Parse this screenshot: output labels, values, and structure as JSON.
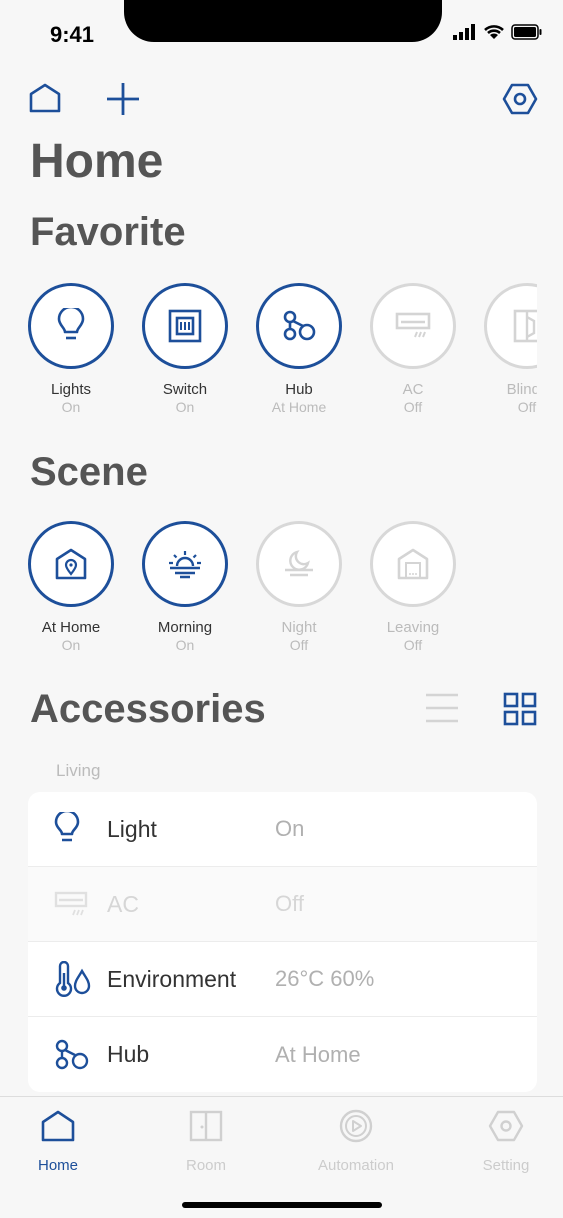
{
  "status": {
    "time": "9:41"
  },
  "header": {
    "title": "Home"
  },
  "favorite": {
    "title": "Favorite",
    "items": [
      {
        "label": "Lights",
        "state": "On",
        "icon": "bulb-icon",
        "active": true
      },
      {
        "label": "Switch",
        "state": "On",
        "icon": "switch-icon",
        "active": true
      },
      {
        "label": "Hub",
        "state": "At Home",
        "icon": "hub-icon",
        "active": true
      },
      {
        "label": "AC",
        "state": "Off",
        "icon": "ac-icon",
        "active": false
      },
      {
        "label": "Blinds",
        "state": "Off",
        "icon": "blinds-icon",
        "active": false
      }
    ]
  },
  "scene": {
    "title": "Scene",
    "items": [
      {
        "label": "At Home",
        "state": "On",
        "icon": "home-location-icon",
        "active": true
      },
      {
        "label": "Morning",
        "state": "On",
        "icon": "sunrise-icon",
        "active": true
      },
      {
        "label": "Night",
        "state": "Off",
        "icon": "moon-icon",
        "active": false
      },
      {
        "label": "Leaving",
        "state": "Off",
        "icon": "leave-home-icon",
        "active": false
      }
    ]
  },
  "accessories": {
    "title": "Accessories",
    "room": "Living",
    "rows": [
      {
        "name": "Light",
        "value": "On",
        "icon": "bulb-icon",
        "active": true
      },
      {
        "name": "AC",
        "value": "Off",
        "icon": "ac-icon",
        "active": false
      },
      {
        "name": "Environment",
        "value": "26°C 60%",
        "icon": "thermo-humidity-icon",
        "active": true
      },
      {
        "name": "Hub",
        "value": "At Home",
        "icon": "hub-icon",
        "active": true
      }
    ]
  },
  "tabs": [
    {
      "label": "Home",
      "icon": "home-icon",
      "active": true
    },
    {
      "label": "Room",
      "icon": "door-icon",
      "active": false
    },
    {
      "label": "Automation",
      "icon": "play-icon",
      "active": false
    },
    {
      "label": "Setting",
      "icon": "hexagon-settings-icon",
      "active": false
    }
  ],
  "colors": {
    "accent": "#1d4f9a",
    "inactive": "#d8d8d8",
    "background": "#f7f7f7"
  }
}
